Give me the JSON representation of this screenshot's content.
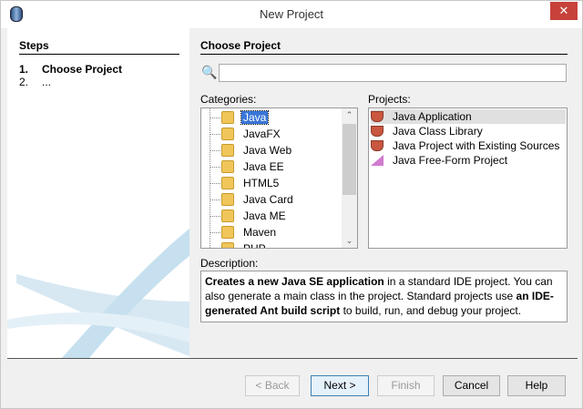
{
  "window": {
    "title": "New Project",
    "close_label": "✕"
  },
  "steps": {
    "heading": "Steps",
    "items": [
      {
        "num": "1.",
        "label": "Choose Project"
      },
      {
        "num": "2.",
        "label": "..."
      }
    ]
  },
  "main": {
    "heading": "Choose Project",
    "search": {
      "value": "",
      "placeholder": ""
    },
    "categories_label": "Categories:",
    "categories": [
      "Java",
      "JavaFX",
      "Java Web",
      "Java EE",
      "HTML5",
      "Java Card",
      "Java ME",
      "Maven",
      "PHP"
    ],
    "projects_label": "Projects:",
    "projects": [
      "Java Application",
      "Java Class Library",
      "Java Project with Existing Sources",
      "Java Free-Form Project"
    ],
    "description_label": "Description:",
    "description": [
      {
        "text": "Creates a new Java SE application",
        "bold": true
      },
      {
        "text": " in a standard IDE project. You can also generate a main class in the project. Standard projects use ",
        "bold": false
      },
      {
        "text": "an IDE-generated Ant build script",
        "bold": true
      },
      {
        "text": " to build, run, and debug your project.",
        "bold": false
      }
    ]
  },
  "buttons": {
    "back": "< Back",
    "next": "Next >",
    "finish": "Finish",
    "cancel": "Cancel",
    "help": "Help"
  }
}
